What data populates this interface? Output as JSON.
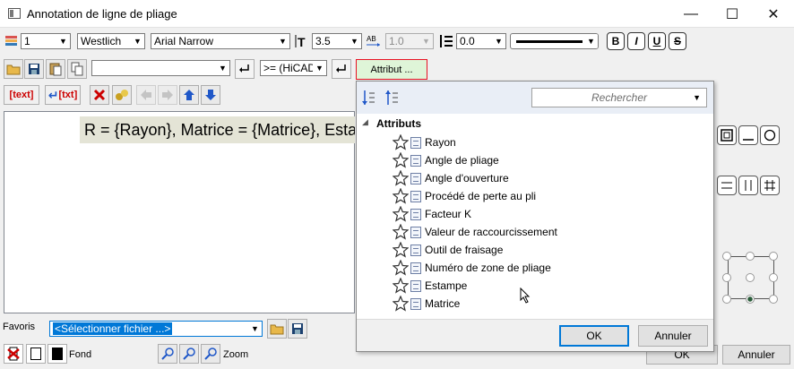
{
  "window": {
    "title": "Annotation de ligne de pliage",
    "minimize": "—",
    "maximize": "☐",
    "close": "✕"
  },
  "toolbar1": {
    "layer_value": "1",
    "style_value": "Westlich",
    "font_value": "Arial Narrow",
    "height_value": "3.5",
    "ratio_value": "1.0",
    "spacing_value": "0.0",
    "bold": "B",
    "italic": "I",
    "underline": "U",
    "strike": "S"
  },
  "toolbar2": {
    "text_combo_value": "",
    "op_combo_value": ">= (HiCAD",
    "attribut_button": "Attribut ..."
  },
  "toolbar3": {
    "text_label": "text",
    "txt_label": "txt"
  },
  "editor": {
    "formula": "R = {Rayon}, Matrice = {Matrice}, Estampe"
  },
  "favoris": {
    "label": "Favoris",
    "placeholder": "<Sélectionner fichier ...>"
  },
  "bottom": {
    "fond_label": "Fond",
    "zoom_label": "Zoom",
    "ok": "OK",
    "annuler": "Annuler"
  },
  "popup": {
    "search_placeholder": "Rechercher",
    "root_label": "Attributs",
    "items": [
      {
        "label": "Rayon"
      },
      {
        "label": "Angle de pliage"
      },
      {
        "label": "Angle d'ouverture"
      },
      {
        "label": "Procédé de perte au pli"
      },
      {
        "label": "Facteur K"
      },
      {
        "label": "Valeur de raccourcissement"
      },
      {
        "label": "Outil de fraisage"
      },
      {
        "label": "Numéro de zone de pliage"
      },
      {
        "label": "Estampe"
      },
      {
        "label": "Matrice"
      }
    ],
    "ok": "OK",
    "annuler": "Annuler"
  },
  "colors": {
    "accent": "#0078d7",
    "attribut_border": "#e81123",
    "formula_bg": "#e4e4d6",
    "icon_blue": "#1f57c8"
  }
}
